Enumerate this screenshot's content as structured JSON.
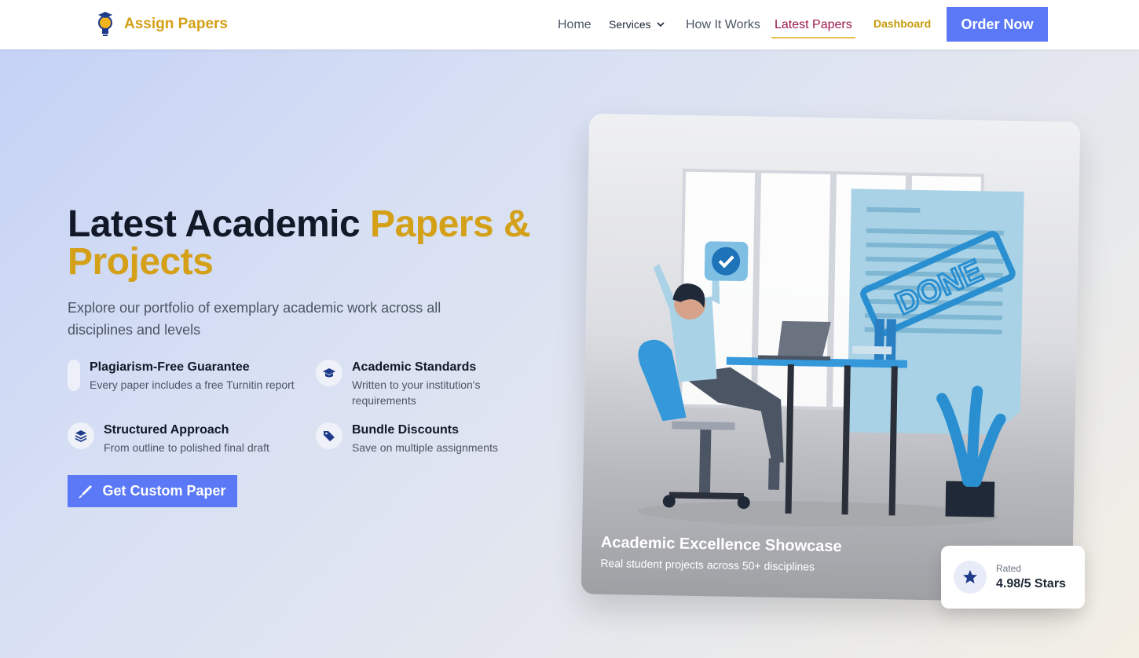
{
  "brand": {
    "name": "Assign Papers",
    "accent": "#d4a017"
  },
  "nav": {
    "home": "Home",
    "services": "Services",
    "how_it_works": "How It Works",
    "latest_papers": "Latest Papers",
    "dashboard": "Dashboard",
    "order_now": "Order Now"
  },
  "hero": {
    "title_main": "Latest Academic ",
    "title_accent": "Papers & Projects",
    "subtitle": "Explore our portfolio of exemplary academic work across all disciplines and levels",
    "cta": "Get Custom Paper"
  },
  "features": [
    {
      "title": "Plagiarism-Free Guarantee",
      "desc": "Every paper includes a free Turnitin report",
      "icon": "blank-pill-icon"
    },
    {
      "title": "Academic Standards",
      "desc": "Written to your institution's requirements",
      "icon": "graduation-cap-icon"
    },
    {
      "title": "Structured Approach",
      "desc": "From outline to polished final draft",
      "icon": "layers-icon"
    },
    {
      "title": "Bundle Discounts",
      "desc": "Save on multiple assignments",
      "icon": "tag-icon"
    }
  ],
  "showcase": {
    "title": "Academic Excellence Showcase",
    "subtitle": "Real student projects across 50+ disciplines",
    "stamp": "DONE"
  },
  "rating": {
    "label": "Rated",
    "value": "4.98/5 Stars"
  },
  "colors": {
    "primary_button": "#5b79f6",
    "active_nav": "#9d174d",
    "underline": "#e3c04f"
  }
}
